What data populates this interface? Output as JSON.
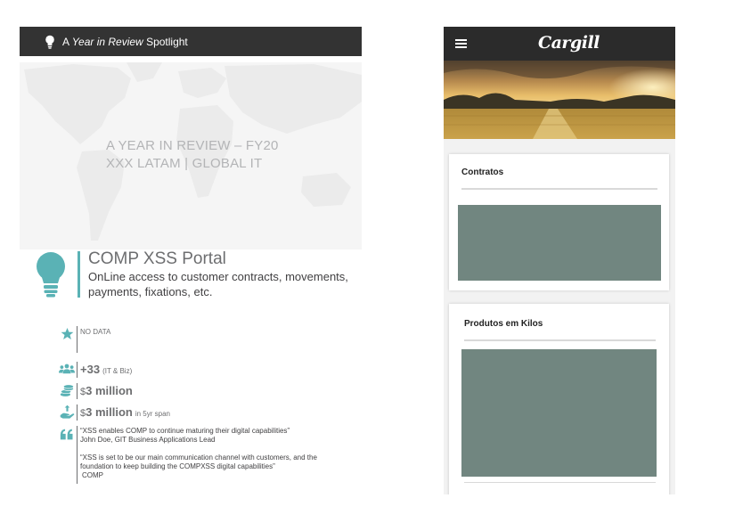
{
  "spotlight": {
    "prefix": "A ",
    "emphasis": "Year in Review",
    "suffix": " Spotlight",
    "icon": "lightbulb-icon"
  },
  "review": {
    "line1": "A YEAR IN REVIEW – FY20",
    "line2": "XXX LATAM | GLOBAL IT"
  },
  "portal": {
    "title": "COMP XSS Portal",
    "description": "OnLine access to customer contracts, movements, payments, fixations, etc.",
    "icon": "lightbulb-icon"
  },
  "stats": {
    "rating": {
      "icon": "star-icon",
      "text": "NO DATA"
    },
    "people": {
      "icon": "people-icon",
      "value": "+33",
      "note": "(IT & Biz)"
    },
    "cost": {
      "icon": "coins-icon",
      "currency": "$",
      "value": "3 million"
    },
    "savings": {
      "icon": "hand-money-icon",
      "currency": "$",
      "value": "3 million",
      "note": "in 5yr span"
    }
  },
  "quotes": {
    "icon": "quote-icon",
    "q1": "“XSS enables COMP to continue maturing their digital capabilities”",
    "a1": "John Doe, GIT Business Applications Lead",
    "q2": "“XSS is set to be our main communication channel with customers, and the foundation to keep building the COMPXSS digital capabilities”",
    "a2": "COMP"
  },
  "phone": {
    "menu_icon": "hamburger-icon",
    "logo": "Cargill",
    "cards": [
      {
        "title": "Contratos"
      },
      {
        "title": "Produtos em Kilos"
      }
    ]
  },
  "colors": {
    "accent_teal": "#5ab2b5",
    "header_dark": "#333333",
    "card_fill": "#718680"
  }
}
